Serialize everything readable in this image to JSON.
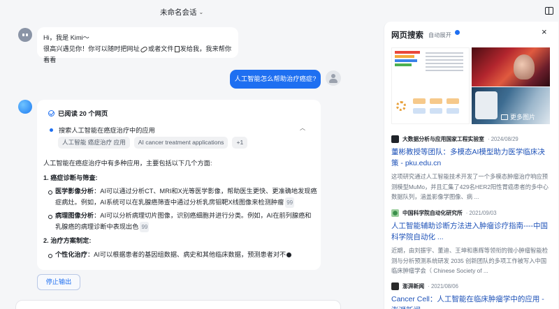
{
  "header": {
    "conversation_title": "未命名会话"
  },
  "greeting": {
    "line1": "Hi，我是 Kimi～",
    "line2_a": "很高兴遇见你！你可以随时把网址",
    "line2_b": "或者文件",
    "line2_c": "发给我，我来帮你看看"
  },
  "user_message": "人工智能怎么帮助治疗癌症?",
  "answer": {
    "read_label": "已阅读 20 个网页",
    "search_label": "搜索人工智能在癌症治疗中的应用",
    "tags": [
      "人工智能 癌症治疗 应用",
      "AI cancer treatment applications",
      "+1"
    ],
    "intro": "人工智能在癌症治疗中有多种应用，主要包括以下几个方面:",
    "section1_title": "1. 癌症诊断与筛查:",
    "s1_b1_label": "医学影像分析",
    "s1_b1_text": "：AI可以通过分析CT、MRI和X光等医学影像，帮助医生更快、更准确地发现癌症病灶。例如，AI系统可以在乳腺癌筛查中通过分析乳房钼靶X线图像来检测肿瘤",
    "s1_b2_label": "病理图像分析",
    "s1_b2_text": "：AI可以分析病理切片图像，识别癌细胞并进行分类。例如，AI在前列腺癌和乳腺癌的病理诊断中表现出色",
    "section2_title": "2. 治疗方案制定:",
    "s2_b1_label": "个性化治疗",
    "s2_b1_text": "：AI可以根据患者的基因组数据、病史和其他临床数据，预测患者对不",
    "quote_mark": "99"
  },
  "stop_button": "停止输出",
  "panel": {
    "title": "网页搜索",
    "auto_expand": "自动展开",
    "more_images": "更多图片",
    "sources": [
      {
        "site": "大数据分析与应用国家工程实验室",
        "date": "· 2024/08/29",
        "title": "董彬教授等团队：多模态AI模型助力医学临床决策 - pku.edu.cn",
        "snippet": "这项研究通过人工智能技术开发了一个多模态肿瘤治疗响应预测模型MuMo，并且汇集了429名HER2阳性胃癌患者的多中心数据队列，涵盖影像学图像、病 ..."
      },
      {
        "site": "中国科学院自动化研究所",
        "date": "· 2021/09/03",
        "title": "人工智能辅助诊断方法进入肿瘤诊疗指南----中国科学院自动化 ...",
        "snippet": "近期，由刘振宇、董迪、王坤和惠辉等领衔的微小肿瘤智能检测与分析预测系统研发 2035 创新团队的多项工作被写入中国临床肿瘤学会（ Chinese Society of ..."
      },
      {
        "site": "澎湃新闻",
        "date": "· 2021/08/06",
        "title": "Cancer Cell：人工智能在临床肿瘤学中的应用 - 澎湃新闻",
        "snippet": ""
      }
    ]
  },
  "colors": {
    "accent": "#1e6ff1",
    "link": "#1e52b8"
  }
}
